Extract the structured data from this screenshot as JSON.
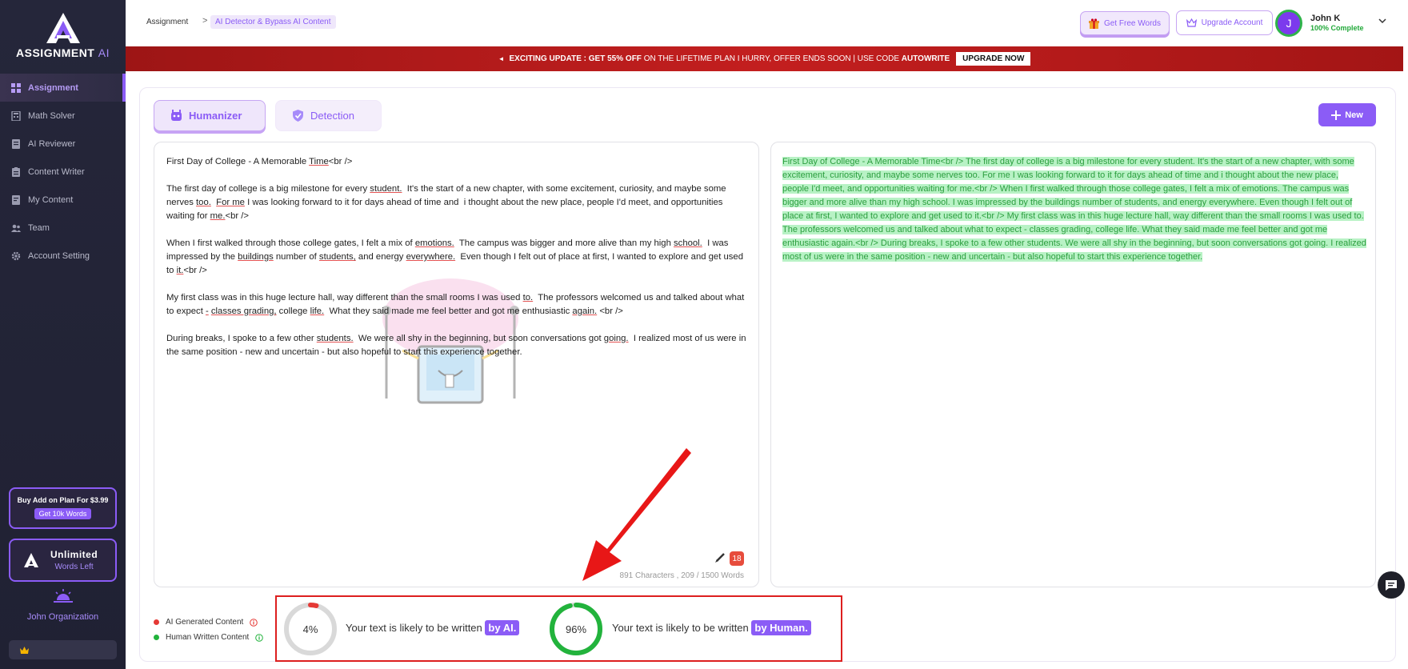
{
  "app": {
    "logo_main": "ASSIGNMENT",
    "logo_accent": "AI"
  },
  "sidebar": {
    "items": [
      {
        "label": "Assignment",
        "icon": "grid-icon",
        "active": true
      },
      {
        "label": "Math Solver",
        "icon": "calculator-icon"
      },
      {
        "label": "AI Reviewer",
        "icon": "document-icon"
      },
      {
        "label": "Content Writer",
        "icon": "clipboard-icon"
      },
      {
        "label": "My Content",
        "icon": "file-icon"
      },
      {
        "label": "Team",
        "icon": "users-icon"
      },
      {
        "label": "Account Setting",
        "icon": "gear-icon"
      }
    ],
    "addon_title": "Buy Add on Plan For $3.99",
    "addon_button": "Get 10k Words",
    "plan_title": "Unlimited",
    "plan_subtitle": "Words Left",
    "org_name": "John Organization"
  },
  "header": {
    "breadcrumb_root": "Assignment",
    "breadcrumb_sep": ">",
    "breadcrumb_current": "AI Detector & Bypass AI Content",
    "free_words_label": "Get Free Words",
    "upgrade_label": "Upgrade Account",
    "user_initial": "J",
    "user_name": "John K",
    "user_status": "100% Complete"
  },
  "banner": {
    "prefix": "EXCITING UPDATE :",
    "offer": "GET 55% OFF",
    "middle": "ON THE LIFETIME PLAN I HURRY, OFFER ENDS SOON | USE CODE",
    "code": "AUTOWRITE",
    "button": "UPGRADE NOW"
  },
  "tabs": {
    "humanizer": "Humanizer",
    "detection": "Detection",
    "new_button": "New"
  },
  "editor": {
    "counter": "891 Characters , 209 / 1500 Words",
    "error_count": "18"
  },
  "output": {
    "segments": [
      "First Day of College - A Memorable Time<br /> The first day of college is a big milestone for every student.",
      " It's the start of a new chapter, with some excitement, curiosity, and maybe some nerves too.",
      " For me I was looking forward to it for days ahead of time and i thought about the new place, people I'd meet, and opportunities waiting for me.<br />",
      " When I first walked through those college gates, I felt a mix of emotions.",
      " The campus was bigger and more alive than my high school.",
      " I was impressed by the buildings number of students, and energy everywhere.",
      " Even though I felt out of place at first, I wanted to explore and get used to it.<br />",
      " My first class was in this huge lecture hall, way different than the small rooms I was used to.",
      " The professors welcomed us and talked about what to expect - classes grading, college life.",
      " What they said made me feel better and got me enthusiastic again.<br />",
      " During breaks, I spoke to a few other students.",
      " We were all shy in the beginning, but soon conversations got going.",
      " I realized most of us were in the same position - new and uncertain - but also hopeful to start this experience together."
    ]
  },
  "legend": {
    "ai_label": "AI Generated Content",
    "human_label": "Human Written Content"
  },
  "scores": {
    "ai_percent": 4,
    "ai_percent_label": "4%",
    "ai_text": "Your text is likely to be written",
    "ai_pill": "by AI.",
    "human_percent": 96,
    "human_percent_label": "96%",
    "human_text": "Your text is likely to be written",
    "human_pill": "by Human."
  },
  "colors": {
    "accent": "#8b5cf6",
    "ai_red": "#e53935",
    "human_green": "#22b33c",
    "banner_red": "#b51a1a"
  }
}
